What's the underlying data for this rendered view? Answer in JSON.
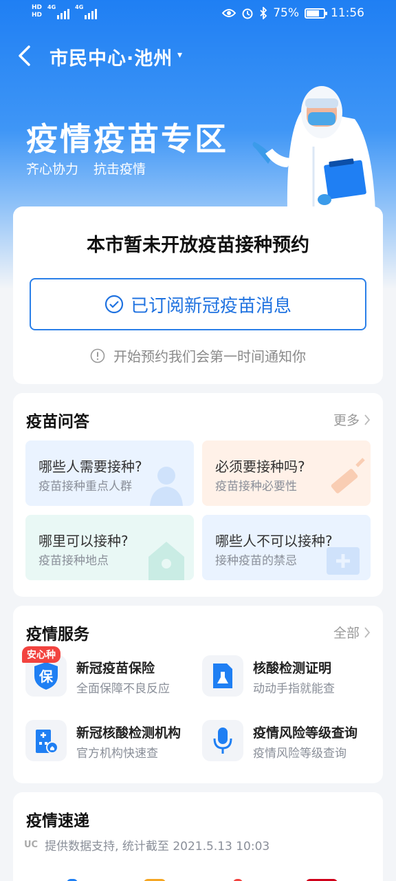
{
  "status_bar": {
    "hd_top": "HD",
    "hd_bottom": "HD",
    "net1": "4G",
    "net2": "4G",
    "battery_pct": "75%",
    "battery_level": 0.75,
    "time": "11:56"
  },
  "nav": {
    "title": "市民中心·池州",
    "caret": "▾"
  },
  "hero": {
    "title": "疫情疫苗专区",
    "subtitle": "齐心协力 抗击疫情"
  },
  "booking": {
    "title": "本市暂未开放疫苗接种预约",
    "subscribe_label": "已订阅新冠疫苗消息",
    "notice": "开始预约我们会第一时间通知你"
  },
  "qa": {
    "title": "疫苗问答",
    "more": "更多",
    "items": [
      {
        "q": "哪些人需要接种?",
        "a": "疫苗接种重点人群"
      },
      {
        "q": "必须要接种吗?",
        "a": "疫苗接种必要性"
      },
      {
        "q": "哪里可以接种?",
        "a": "疫苗接种地点"
      },
      {
        "q": "哪些人不可以接种?",
        "a": "接种疫苗的禁忌"
      }
    ]
  },
  "services": {
    "title": "疫情服务",
    "all": "全部",
    "tag": "安心种",
    "items": [
      {
        "name": "新冠疫苗保险",
        "desc": "全面保障不良反应",
        "icon_text": "保"
      },
      {
        "name": "核酸检测证明",
        "desc": "动动手指就能查"
      },
      {
        "name": "新冠核酸检测机构",
        "desc": "官方机构快速查"
      },
      {
        "name": "疫情风险等级查询",
        "desc": "疫情风险等级查询"
      }
    ]
  },
  "news": {
    "title": "疫情速递",
    "source_logo": "UC",
    "source": "提供数据支持, 统计截至 2021.5.13 10:03"
  },
  "colors": {
    "primary": "#1f7ff3",
    "accent_red": "#f2433f"
  }
}
